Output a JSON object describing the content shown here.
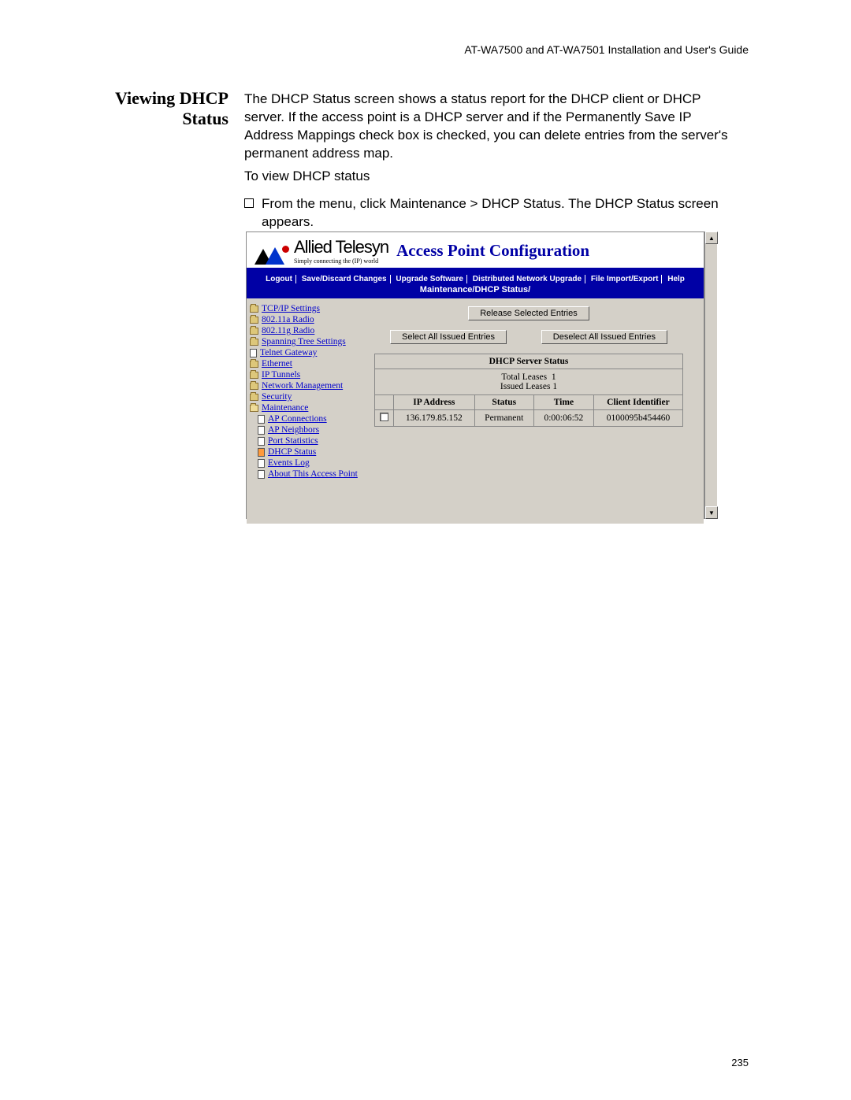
{
  "doc_header": "AT-WA7500 and AT-WA7501 Installation and User's Guide",
  "section_title": "Viewing DHCP Status",
  "body_para": "The DHCP Status screen shows a status report for the DHCP client or DHCP server. If the access point is a DHCP server and if the Permanently Save IP Address Mappings check box is checked, you can delete entries from the server's permanent address map.",
  "instr_title": "To view DHCP status",
  "instr_step": "From the menu, click Maintenance > DHCP Status. The DHCP Status screen appears.",
  "page_num": "235",
  "app": {
    "brand_name": "Allied Telesyn",
    "brand_tag": "Simply connecting the (IP) world",
    "app_title": "Access Point Configuration",
    "menu": {
      "logout": "Logout",
      "save": "Save/Discard Changes",
      "upgrade": "Upgrade Software",
      "dist": "Distributed Network Upgrade",
      "file": "File Import/Export",
      "help": "Help"
    },
    "crumb": "Maintenance/DHCP Status/",
    "nav": [
      "TCP/IP Settings",
      "802.11a Radio",
      "802.11g Radio",
      "Spanning Tree Settings",
      "Telnet Gateway",
      "Ethernet",
      "IP Tunnels",
      "Network Management",
      "Security",
      "Maintenance"
    ],
    "nav_sub": [
      "AP Connections",
      "AP Neighbors",
      "Port Statistics",
      "DHCP Status",
      "Events Log",
      "About This Access Point"
    ],
    "buttons": {
      "release": "Release Selected Entries",
      "select_all": "Select All Issued Entries",
      "deselect_all": "Deselect All Issued Entries"
    },
    "table": {
      "title": "DHCP Server Status",
      "total_leases_label": "Total Leases",
      "total_leases_val": "1",
      "issued_leases_label": "Issued Leases",
      "issued_leases_val": "1",
      "h_ip": "IP Address",
      "h_status": "Status",
      "h_time": "Time",
      "h_client": "Client Identifier",
      "row": {
        "ip": "136.179.85.152",
        "status": "Permanent",
        "time": "0:00:06:52",
        "client": "0100095b454460"
      }
    }
  }
}
